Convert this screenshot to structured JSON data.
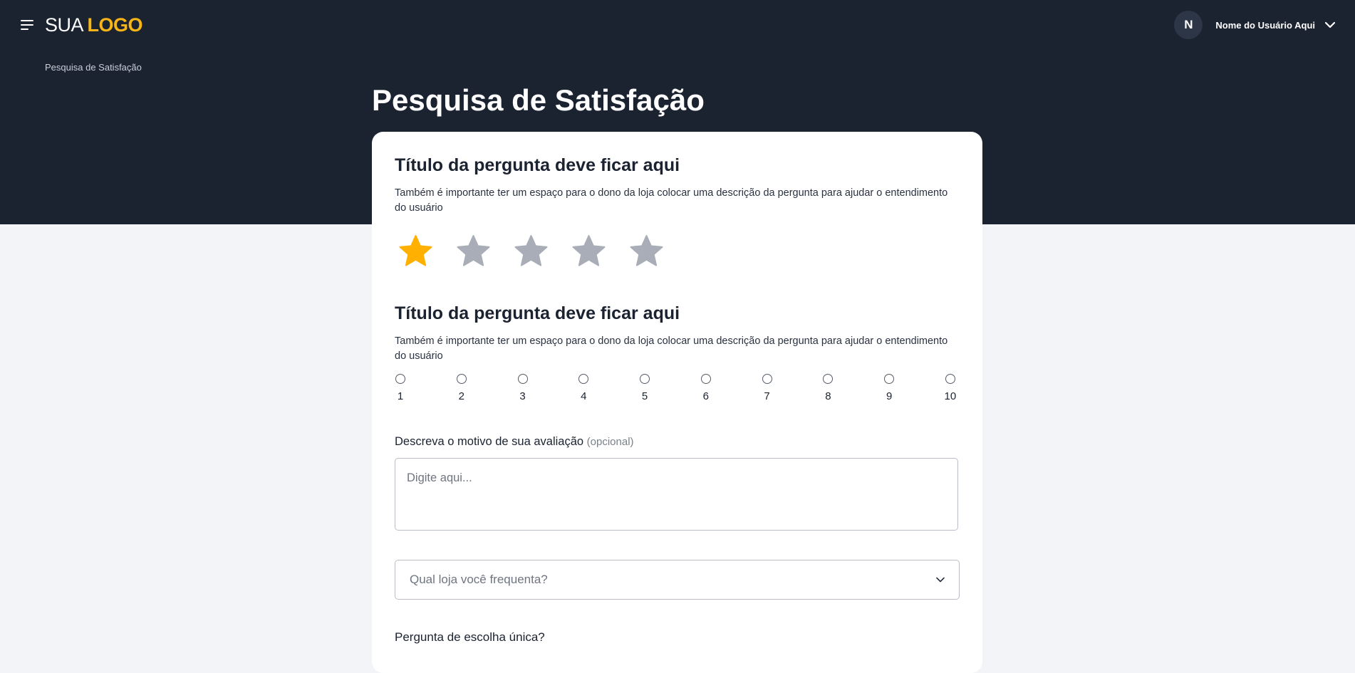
{
  "header": {
    "logo_prefix": "SUA",
    "logo_brand": "LOGO",
    "user_initial": "N",
    "user_name": "Nome do Usuário Aqui",
    "menu_icon": "hamburger-menu-icon",
    "dropdown_icon": "chevron-down-icon"
  },
  "breadcrumb": "Pesquisa de Satisfação",
  "page_title": "Pesquisa de Satisfação",
  "questions": [
    {
      "title": "Título da pergunta deve ficar aqui",
      "description": "Também é importante ter um espaço para o dono da loja colocar uma descrição da pergunta para ajudar o entendimento do usuário",
      "rating": {
        "max": 5,
        "selected": 1
      }
    },
    {
      "title": "Título da pergunta deve ficar aqui",
      "description": "Também é importante ter um espaço para o dono da loja colocar uma descrição da pergunta para ajudar o entendimento do usuário",
      "scale": [
        "1",
        "2",
        "3",
        "4",
        "5",
        "6",
        "7",
        "8",
        "9",
        "10"
      ]
    }
  ],
  "reason": {
    "label": "Descreva o motivo de sua avaliação",
    "optional": "(opcional)",
    "placeholder": "Digite aqui..."
  },
  "store_select": {
    "placeholder": "Qual loja você frequenta?"
  },
  "single_choice_question": "Pergunta de escolha única?",
  "colors": {
    "header_bg": "#1b2230",
    "brand_yellow": "#f8b616",
    "star_active": "#ffb000",
    "star_inactive": "#a8adb7",
    "page_bg": "#f3f4f7"
  }
}
